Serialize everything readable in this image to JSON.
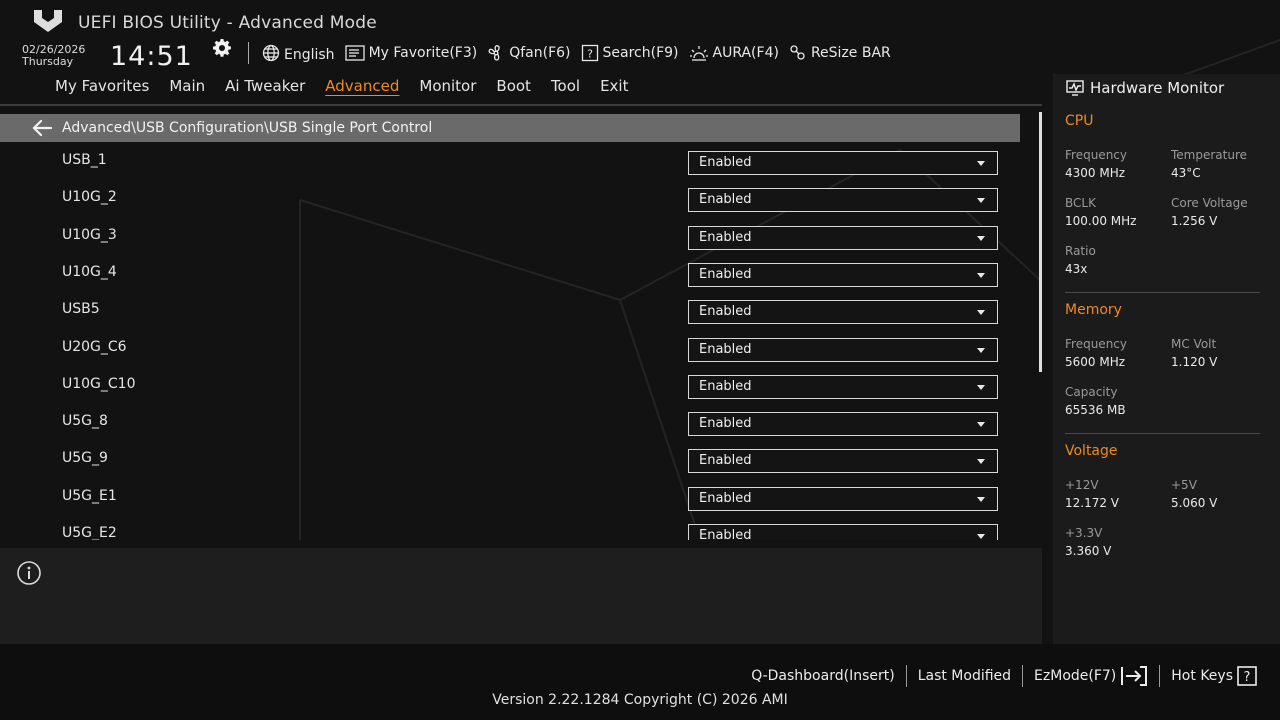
{
  "header": {
    "title": "UEFI BIOS Utility - Advanced Mode",
    "date": "02/26/2026",
    "day": "Thursday",
    "time": "14:51",
    "toolbar": {
      "language": "English",
      "my_favorite": "My Favorite(F3)",
      "qfan": "Qfan(F6)",
      "search": "Search(F9)",
      "aura": "AURA(F4)",
      "resize_bar": "ReSize BAR"
    }
  },
  "menu": {
    "items": [
      "My Favorites",
      "Main",
      "Ai Tweaker",
      "Advanced",
      "Monitor",
      "Boot",
      "Tool",
      "Exit"
    ],
    "active": "Advanced"
  },
  "breadcrumb": "Advanced\\USB Configuration\\USB Single Port Control",
  "settings": [
    {
      "label": "USB_1",
      "value": "Enabled"
    },
    {
      "label": "U10G_2",
      "value": "Enabled"
    },
    {
      "label": "U10G_3",
      "value": "Enabled"
    },
    {
      "label": "U10G_4",
      "value": "Enabled"
    },
    {
      "label": "USB5",
      "value": "Enabled"
    },
    {
      "label": "U20G_C6",
      "value": "Enabled"
    },
    {
      "label": "U10G_C10",
      "value": "Enabled"
    },
    {
      "label": "U5G_8",
      "value": "Enabled"
    },
    {
      "label": "U5G_9",
      "value": "Enabled"
    },
    {
      "label": "U5G_E1",
      "value": "Enabled"
    },
    {
      "label": "U5G_E2",
      "value": "Enabled"
    }
  ],
  "hardware_monitor": {
    "title": "Hardware Monitor",
    "cpu": {
      "heading": "CPU",
      "frequency_label": "Frequency",
      "frequency": "4300 MHz",
      "temperature_label": "Temperature",
      "temperature": "43°C",
      "bclk_label": "BCLK",
      "bclk": "100.00 MHz",
      "core_voltage_label": "Core Voltage",
      "core_voltage": "1.256 V",
      "ratio_label": "Ratio",
      "ratio": "43x"
    },
    "memory": {
      "heading": "Memory",
      "frequency_label": "Frequency",
      "frequency": "5600 MHz",
      "mc_volt_label": "MC Volt",
      "mc_volt": "1.120 V",
      "capacity_label": "Capacity",
      "capacity": "65536 MB"
    },
    "voltage": {
      "heading": "Voltage",
      "v12_label": "+12V",
      "v12": "12.172 V",
      "v5_label": "+5V",
      "v5": "5.060 V",
      "v33_label": "+3.3V",
      "v33": "3.360 V"
    }
  },
  "footer": {
    "q_dashboard": "Q-Dashboard(Insert)",
    "last_modified": "Last Modified",
    "ezmode": "EzMode(F7)",
    "hot_keys": "Hot Keys",
    "version": "Version 2.22.1284 Copyright (C) 2026 AMI"
  },
  "colors": {
    "accent": "#f08a1c",
    "background": "#121212",
    "breadcrumb_bg": "#6a6a6a"
  }
}
